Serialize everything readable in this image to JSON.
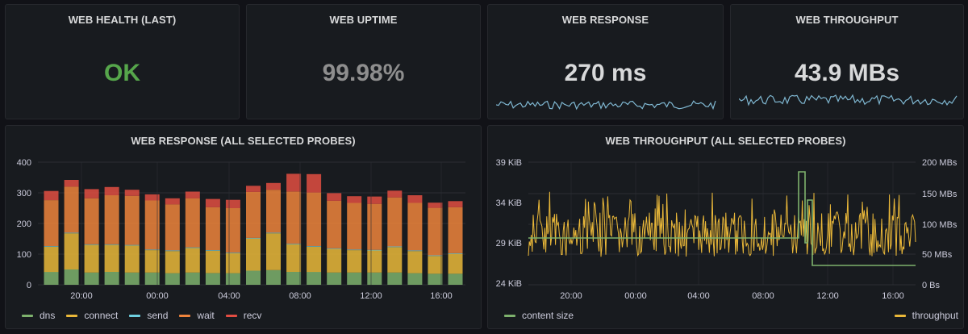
{
  "colors": {
    "ok": "#56a64b",
    "uptime": "#8e8e8e",
    "text": "#d8d9da",
    "sparkline": "#7fb7d1",
    "dns": "#7eb26d",
    "connect": "#eab839",
    "send": "#6ed0e0",
    "wait": "#ef843c",
    "recv": "#e24d42",
    "content_size": "#7eb26d",
    "throughput": "#eab839"
  },
  "panels": {
    "health": {
      "title": "WEB HEALTH (LAST)",
      "value": "OK"
    },
    "uptime": {
      "title": "WEB UPTIME",
      "value": "99.98%"
    },
    "response": {
      "title": "WEB RESPONSE",
      "value": "270 ms"
    },
    "throughput": {
      "title": "WEB THROUGHPUT",
      "value": "43.9 MBs"
    },
    "response_chart": {
      "title": "WEB RESPONSE (ALL SELECTED PROBES)"
    },
    "throughput_chart": {
      "title": "WEB THROUGHPUT (ALL SELECTED PROBES)"
    }
  },
  "chart_data": [
    {
      "type": "bar",
      "stacked": true,
      "title": "WEB RESPONSE (ALL SELECTED PROBES)",
      "y_ticks": [
        "400",
        "300",
        "200",
        "100",
        "0"
      ],
      "ylim": [
        0,
        400
      ],
      "x_ticks": [
        "20:00",
        "00:00",
        "04:00",
        "08:00",
        "12:00",
        "16:00"
      ],
      "legend": [
        "dns",
        "connect",
        "send",
        "wait",
        "recv"
      ],
      "legend_position": "bottom-left",
      "grid": true,
      "series": [
        {
          "name": "dns",
          "values": [
            42,
            50,
            40,
            42,
            40,
            40,
            38,
            40,
            38,
            38,
            46,
            48,
            42,
            42,
            40,
            40,
            40,
            40,
            38,
            36,
            36
          ]
        },
        {
          "name": "connect",
          "values": [
            82,
            118,
            90,
            88,
            88,
            73,
            72,
            80,
            73,
            65,
            105,
            120,
            90,
            82,
            77,
            73,
            72,
            83,
            72,
            58,
            65
          ]
        },
        {
          "name": "send",
          "values": [
            2,
            2,
            2,
            2,
            2,
            2,
            2,
            2,
            2,
            2,
            2,
            2,
            2,
            2,
            2,
            2,
            2,
            2,
            2,
            2,
            2
          ]
        },
        {
          "name": "wait",
          "values": [
            150,
            150,
            150,
            160,
            160,
            160,
            150,
            160,
            140,
            145,
            150,
            140,
            170,
            175,
            155,
            152,
            150,
            160,
            155,
            155,
            150
          ]
        },
        {
          "name": "recv",
          "values": [
            30,
            22,
            30,
            27,
            20,
            20,
            20,
            22,
            27,
            27,
            20,
            22,
            58,
            60,
            25,
            22,
            24,
            22,
            25,
            17,
            20
          ]
        }
      ]
    },
    {
      "type": "line",
      "title": "WEB THROUGHPUT (ALL SELECTED PROBES)",
      "y_ticks_left": [
        "39 KiB",
        "34 KiB",
        "29 KiB",
        "24 KiB"
      ],
      "y_ticks_right": [
        "200 MBs",
        "150 MBs",
        "100 MBs",
        "50 MBs",
        "0 Bs"
      ],
      "x_ticks": [
        "20:00",
        "00:00",
        "04:00",
        "08:00",
        "12:00",
        "16:00"
      ],
      "legend": [
        "content size",
        "throughput"
      ],
      "grid": true
    }
  ]
}
